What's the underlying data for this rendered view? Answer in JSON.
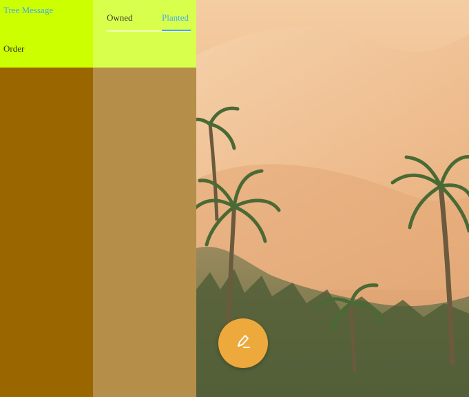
{
  "nav": {
    "tree_message_label": "Tree Message",
    "order_label": "Order"
  },
  "tabs": {
    "items": [
      {
        "label": "Owned",
        "selected": false
      },
      {
        "label": "Planted",
        "selected": true
      }
    ]
  },
  "fab": {
    "icon": "edit-pencil-icon"
  },
  "colors": {
    "nav_top_bg": "#ccff00",
    "nav_bottom_bg": "#996600",
    "tabs_top_bg": "#d9ff4d",
    "tabs_bottom_bg": "#b58f4a",
    "link_blue": "#3fa9f5",
    "text_dark": "#333333",
    "fab_bg": "#eea93c",
    "fab_icon": "#ffffff"
  }
}
